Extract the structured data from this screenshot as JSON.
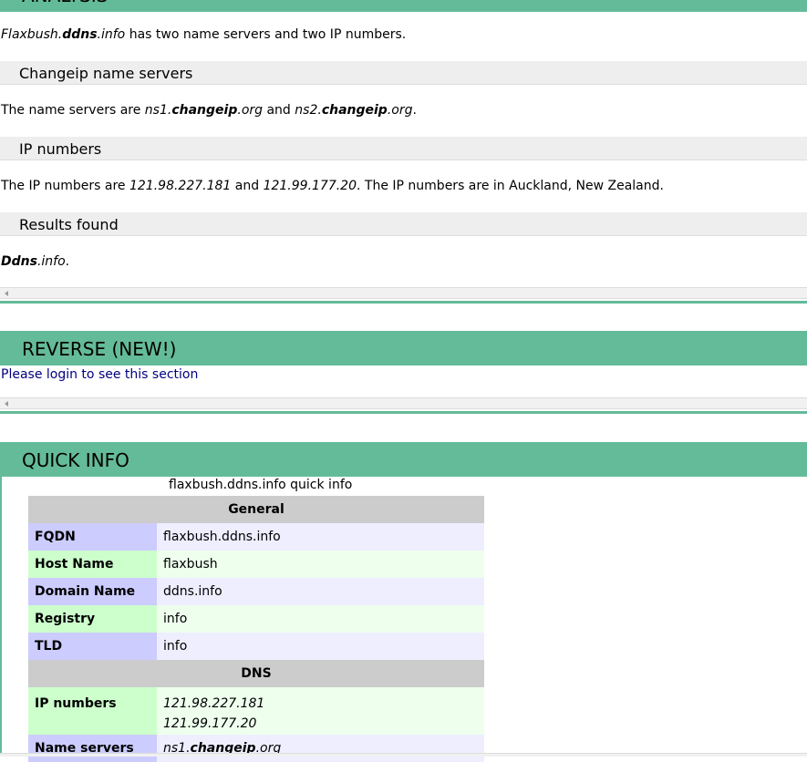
{
  "analysis": {
    "header": "ANALYSIS",
    "intro": {
      "name_italic": "Flaxbush",
      "name_dot1": ".",
      "name_bold": "ddns",
      "name_dot2": ".",
      "name_tld": "info",
      "rest": " has two name servers and two IP numbers."
    },
    "nameservers_heading": "Changeip name servers",
    "nameservers": {
      "prefix": "The name servers are ",
      "ns1_a": "ns1",
      "ns1_b": "changeip",
      "ns1_c": "org",
      "and": " and ",
      "ns2_a": "ns2",
      "ns2_b": "changeip",
      "ns2_c": "org",
      "suffix": "."
    },
    "ip_heading": "IP numbers",
    "ip": {
      "prefix": "The IP numbers are ",
      "ip1": "121.98.227.181",
      "and": " and ",
      "ip2": "121.99.177.20",
      "suffix": ". The IP numbers are in Auckland, New Zealand."
    },
    "results_heading": "Results found",
    "results": {
      "bold": "Ddns",
      "dot": ".",
      "tld": "info",
      "suffix": "."
    }
  },
  "reverse": {
    "header": "REVERSE (NEW!)",
    "login_text": "Please login to see this section"
  },
  "quick_info": {
    "header": "QUICK INFO",
    "caption": "flaxbush.ddns.info quick info",
    "general_heading": "General",
    "general_rows": [
      {
        "key": "FQDN",
        "value": "flaxbush.ddns.info"
      },
      {
        "key": "Host Name",
        "value": "flaxbush"
      },
      {
        "key": "Domain Name",
        "value": "ddns.info"
      },
      {
        "key": "Registry",
        "value": "info"
      },
      {
        "key": "TLD",
        "value": "info"
      }
    ],
    "dns_heading": "DNS",
    "ip_numbers_label": "IP numbers",
    "ip_numbers": [
      "121.98.227.181",
      "121.99.177.20"
    ],
    "name_servers_label": "Name servers",
    "name_server_first": {
      "a": "ns1",
      "b": "changeip",
      "c": "org"
    }
  },
  "colors": {
    "section_header": "#64bb99",
    "sub_heading_bg": "#eeeeee",
    "login_link": "#000080"
  }
}
